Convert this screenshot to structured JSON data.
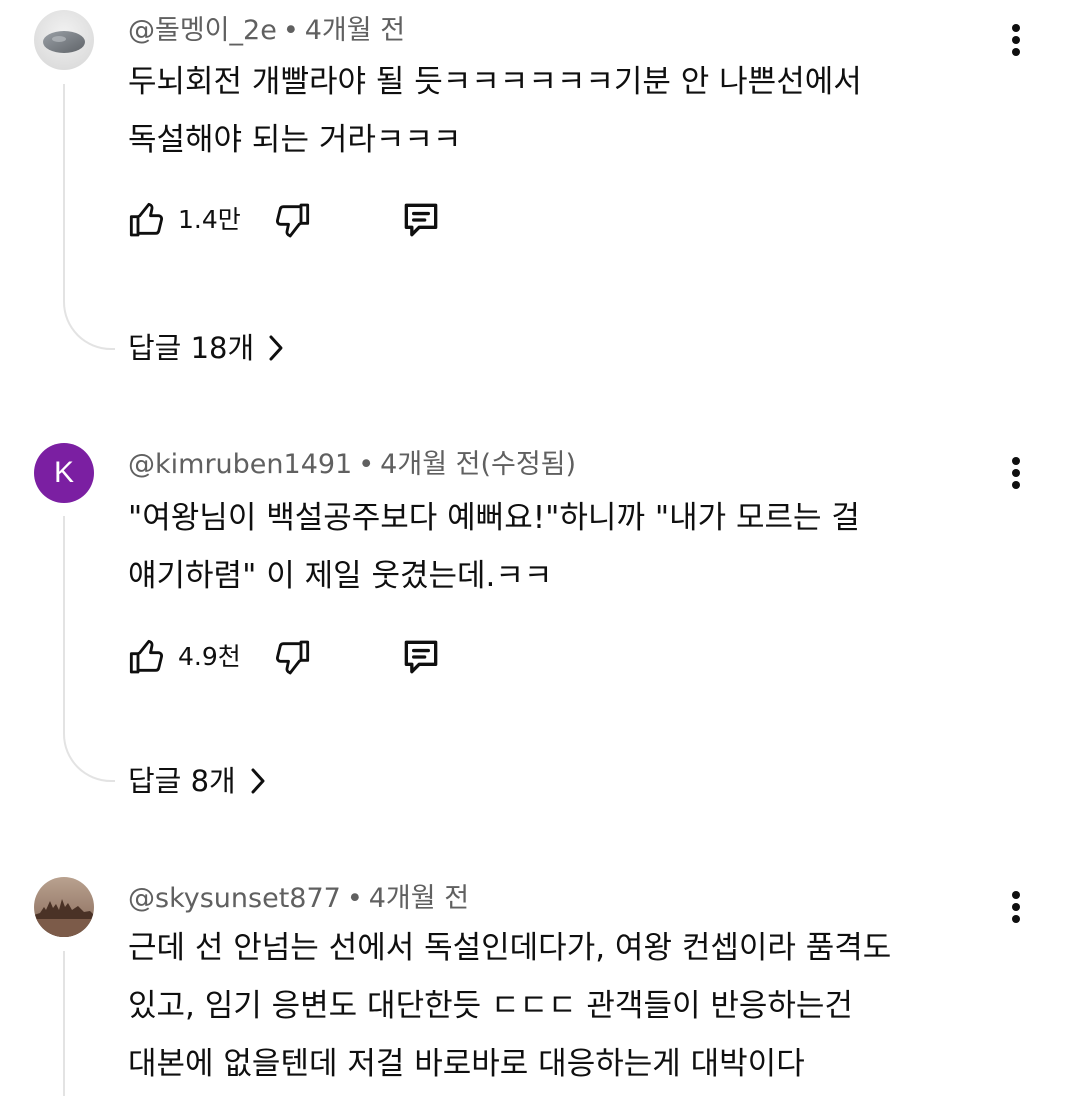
{
  "comments": [
    {
      "avatar_icon": "stone-photo-avatar",
      "author": "@돌멩이_2e",
      "separator": "•",
      "time": "4개월 전",
      "text_lines": [
        "두뇌회전 개빨라야 될 듯ㅋㅋㅋㅋㅋㅋ기분 안 나쁜선에서",
        "독설해야 되는 거라ㅋㅋㅋ"
      ],
      "likes": "1.4만",
      "replies_label": "답글 18개"
    },
    {
      "avatar_letter": "K",
      "avatar_color": "#7b1fa2",
      "author": "@kimruben1491",
      "separator": "•",
      "time": "4개월 전(수정됨)",
      "text_lines": [
        "\"여왕님이 백설공주보다 예뻐요!\"하니까 \"내가 모르는 걸",
        "얘기하렴\"  이 제일 웃겼는데.ㅋㅋ"
      ],
      "likes": "4.9천",
      "replies_label": "답글 8개"
    },
    {
      "avatar_icon": "sunset-castle-photo-avatar",
      "author": "@skysunset877",
      "separator": "•",
      "time": "4개월 전",
      "text_lines": [
        "근데 선 안넘는 선에서 독설인데다가, 여왕 컨셉이라 품격도",
        "있고, 임기 응변도 대단한듯 ㄷㄷㄷ 관객들이 반응하는건",
        "대본에 없을텐데 저걸 바로바로 대응하는게 대박이다"
      ]
    }
  ],
  "colors": {
    "meta_text": "#606060",
    "body_text": "#0f0f0f",
    "thread_line": "#e3e3e3"
  }
}
